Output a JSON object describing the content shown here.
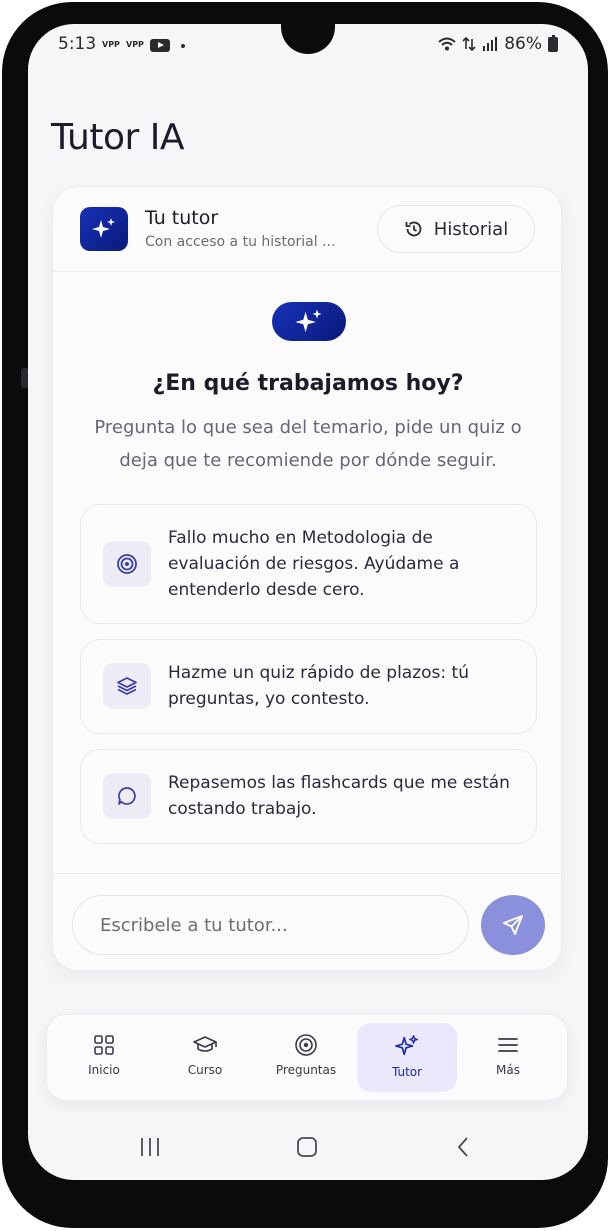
{
  "status_bar": {
    "time": "5:13",
    "indicators": [
      "VPP",
      "VPP"
    ],
    "battery": "86%"
  },
  "page": {
    "title": "Tutor IA"
  },
  "tutor_header": {
    "name": "Tu tutor",
    "subtitle": "Con acceso a tu historial ...",
    "history_button": "Historial"
  },
  "hero": {
    "title": "¿En qué trabajamos hoy?",
    "text": "Pregunta lo que sea del temario, pide un quiz o deja que te recomiende por dónde seguir."
  },
  "suggestions": [
    {
      "icon": "target-icon",
      "text": "Fallo mucho en Metodologia de evaluación de riesgos. Ayúdame a entenderlo desde cero."
    },
    {
      "icon": "layers-icon",
      "text": "Hazme un quiz rápido de plazos: tú preguntas, yo contesto."
    },
    {
      "icon": "chat-bubble-icon",
      "text": "Repasemos las flashcards que me están costando trabajo."
    }
  ],
  "composer": {
    "placeholder": "Escribele a tu tutor..."
  },
  "nav": {
    "items": [
      {
        "label": "Inicio",
        "icon": "grid-icon"
      },
      {
        "label": "Curso",
        "icon": "graduation-cap-icon"
      },
      {
        "label": "Preguntas",
        "icon": "target-icon"
      },
      {
        "label": "Tutor",
        "icon": "sparkles-icon",
        "active": true
      },
      {
        "label": "Más",
        "icon": "menu-icon"
      }
    ]
  },
  "colors": {
    "accent_dark": "#0a1a7a",
    "accent": "#1731b8",
    "send_button": "#8b90dc",
    "active_tab_bg": "#ebe8fb"
  }
}
